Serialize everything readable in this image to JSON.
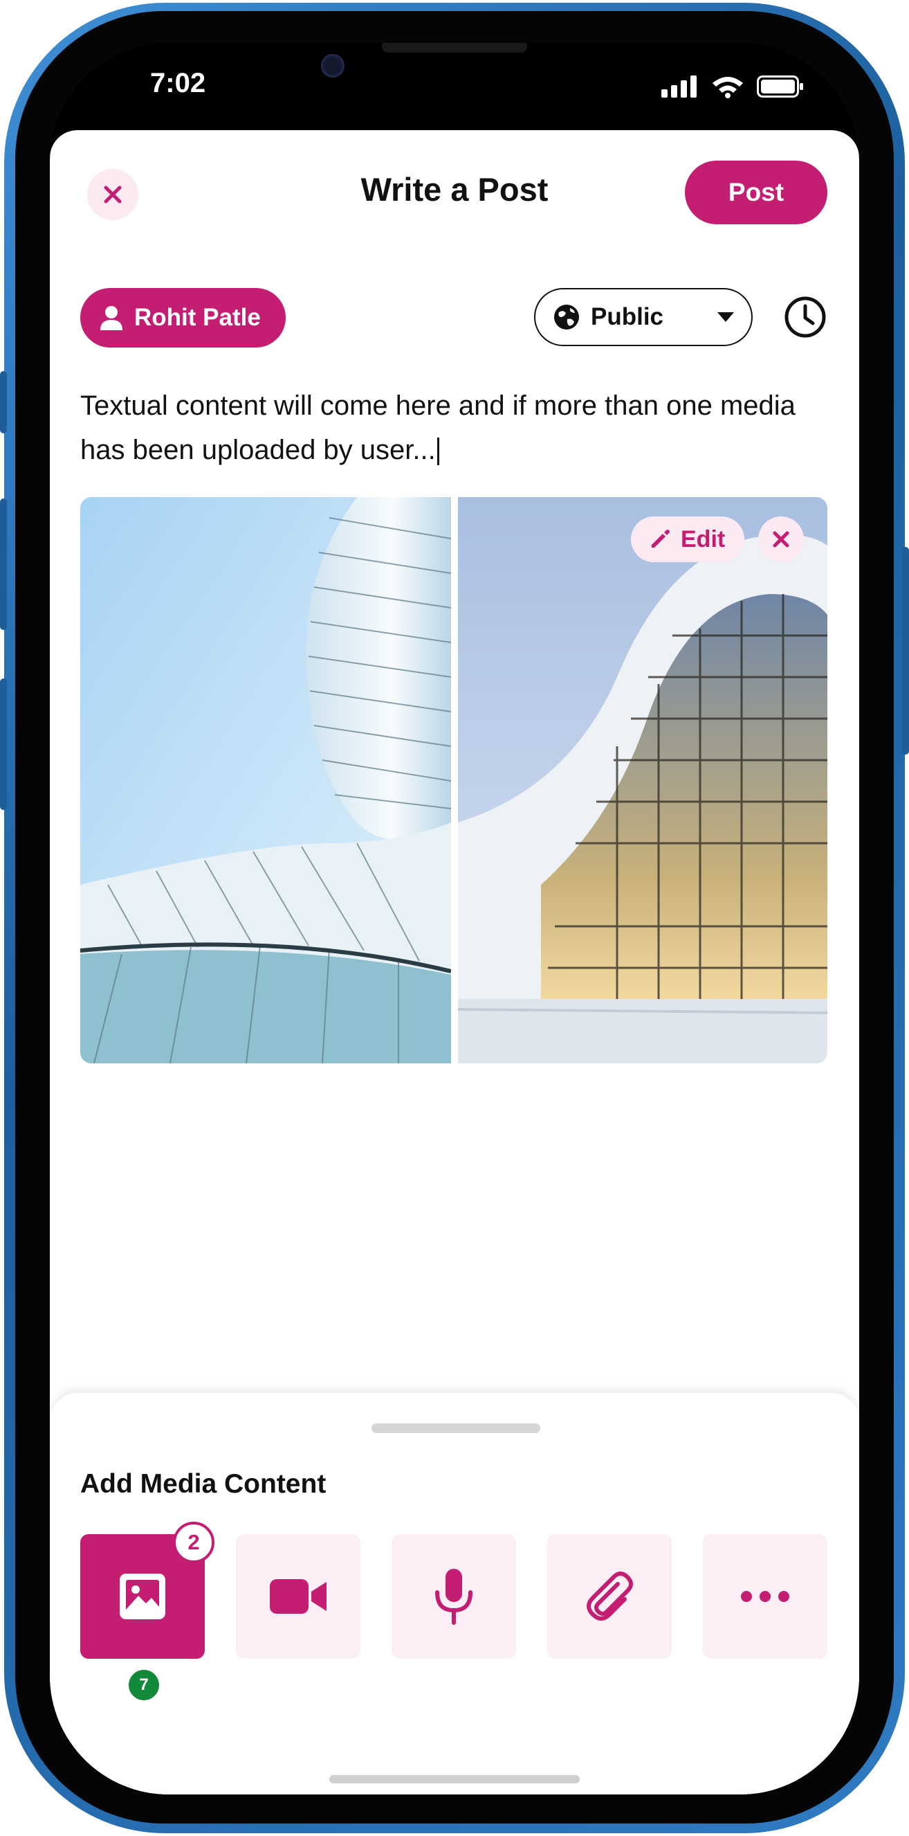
{
  "status_bar": {
    "time": "7:02"
  },
  "header": {
    "title": "Write a Post",
    "post_label": "Post"
  },
  "author": {
    "name": "Rohit Patle"
  },
  "visibility": {
    "selected": "Public"
  },
  "composer": {
    "text": "Textual content will come here and if more than one media has been uploaded by user..."
  },
  "media_preview": {
    "edit_label": "Edit"
  },
  "media_sheet": {
    "title": "Add Media Content",
    "tiles": [
      {
        "icon": "image-icon",
        "badge": "2",
        "sub_badge": "7"
      },
      {
        "icon": "video-icon"
      },
      {
        "icon": "microphone-icon"
      },
      {
        "icon": "paperclip-icon"
      },
      {
        "icon": "more-icon"
      }
    ]
  },
  "colors": {
    "accent": "#c41e72",
    "accent_light": "#fbeaf2",
    "success": "#138a3a"
  }
}
